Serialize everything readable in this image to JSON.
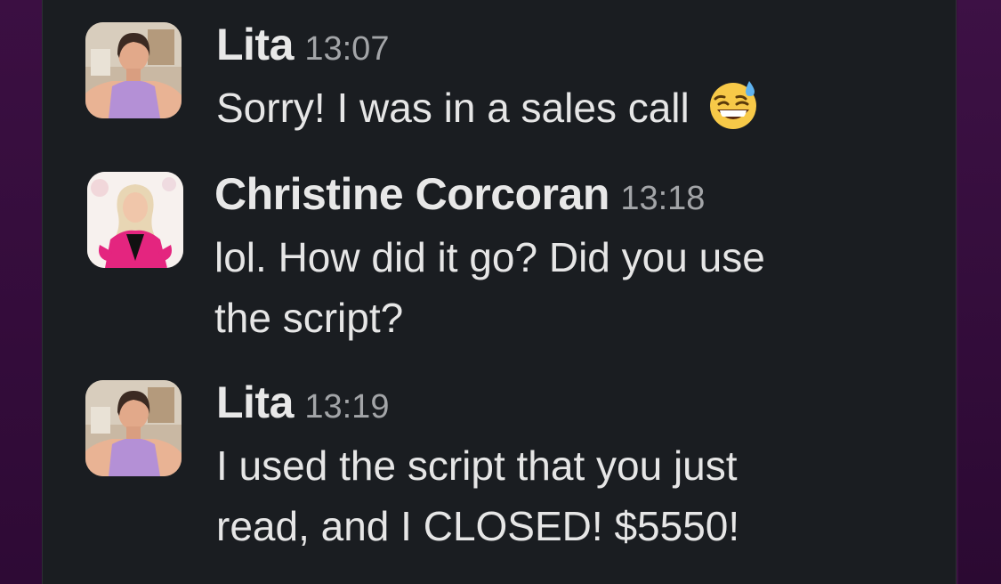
{
  "messages": [
    {
      "author": "Lita",
      "time": "13:07",
      "text": "Sorry! I was in a sales call",
      "emoji": "grinning-face-with-sweat-icon"
    },
    {
      "author": "Christine Corcoran",
      "time": "13:18",
      "lines": [
        "lol. How did it go? Did you use",
        "the script?"
      ]
    },
    {
      "author": "Lita",
      "time": "13:19",
      "lines": [
        "I used the script that you just",
        "read, and I CLOSED! $5550!"
      ]
    }
  ],
  "colors": {
    "background": "#1a1d21",
    "sidebar": "#3a1040",
    "author": "#e8e8e8",
    "timestamp": "#a3a5a8",
    "text": "#e6e6e6"
  }
}
